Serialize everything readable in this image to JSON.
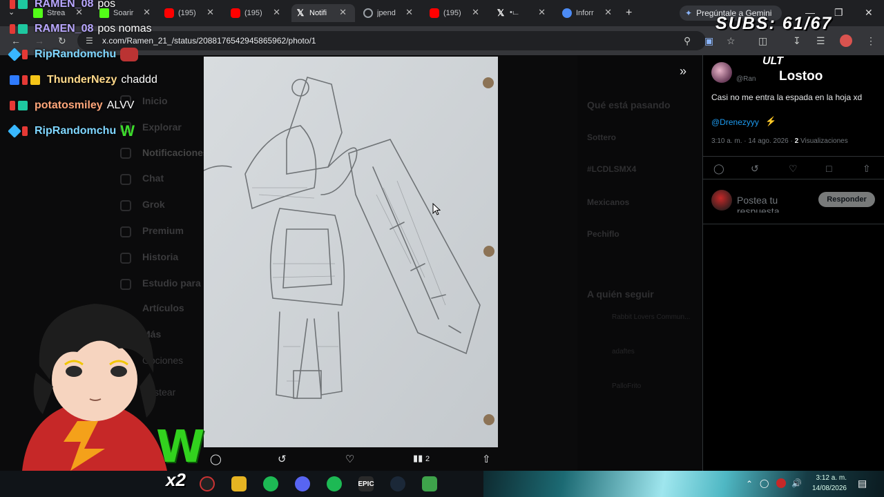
{
  "browser": {
    "tabs": [
      {
        "label": "Strea",
        "icon": "kick-icon",
        "color": "#53fc18"
      },
      {
        "label": "Soarir",
        "icon": "kick-icon",
        "color": "#53fc18"
      },
      {
        "label": "(195)",
        "icon": "youtube-icon",
        "color": "#ff0000"
      },
      {
        "label": "(195)",
        "icon": "youtube-icon",
        "color": "#ff0000"
      },
      {
        "label": "Notifi",
        "icon": "x-icon",
        "color": "#ffffff"
      },
      {
        "label": "jpend",
        "icon": "globe-icon",
        "color": "#9aa0a6"
      },
      {
        "label": "(195)",
        "icon": "youtube-icon",
        "color": "#ff0000"
      },
      {
        "label": "•ட",
        "icon": "x-icon",
        "color": "#ffffff"
      },
      {
        "label": "Inforr",
        "icon": "app-icon",
        "color": "#4c8bf5"
      }
    ],
    "gemini_label": "Pregúntale a Gemini",
    "url": "x.com/Ramen_21_/status/2088176542945865962/photo/1"
  },
  "x_nav": [
    "Inicio",
    "Explorar",
    "Notificaciones",
    "Chat",
    "Grok",
    "Premium",
    "Historia",
    "Estudio para",
    "Artículos",
    "Más",
    "Opciones",
    "Postear"
  ],
  "trends": {
    "heading": "Qué está pasando",
    "items": [
      "Sottero",
      "#LCDLSMX4",
      "Mexicanos",
      "Pechiflo"
    ],
    "who_to_follow": "A quién seguir",
    "suggestions": [
      "Rabbit Lovers Commun...",
      "adaftes",
      "PalloFrito"
    ]
  },
  "post": {
    "handle": "@Ran",
    "text": "Casi no me entra la espada en la hoja xd",
    "mention": "@Drenezyyy",
    "time": "3:10 a. m.",
    "date": "14 ago. 2026",
    "views_count": "2",
    "views_label": "Visualizaciones",
    "reply_placeholder": "Postea tu respuesta",
    "reply_button": "Responder"
  },
  "photo_bar": {
    "views": "2"
  },
  "chat": [
    {
      "user": "RAMEN_08",
      "msg": "pos",
      "color": "#b9a7ff",
      "badges": [
        "#e53935",
        "#1ec8a0"
      ]
    },
    {
      "user": "RAMEN_08",
      "msg": "pos nomas",
      "color": "#b9a7ff",
      "badges": [
        "#e53935",
        "#1ec8a0"
      ]
    },
    {
      "user": "RipRandomchu",
      "msg": "",
      "color": "#7fd6ff",
      "badges": [
        "#39b7ff",
        "#e53935"
      ]
    },
    {
      "user": "ThunderNezy",
      "msg": "chaddd",
      "color": "#ffd98a",
      "badges": [
        "#2f7bff",
        "#e53935",
        "#f5c518"
      ]
    },
    {
      "user": "potatosmiley",
      "msg": "ALVV",
      "color": "#ffa67a",
      "badges": [
        "#e53935",
        "#1ec8a0"
      ]
    },
    {
      "user": "RipRandomchu",
      "msg": "",
      "emote": "W",
      "color": "#7fd6ff",
      "badges": [
        "#39b7ff",
        "#e53935"
      ]
    }
  ],
  "overlay": {
    "subs": "SUBS: 61/67",
    "ult_tag": "ULT",
    "ult_name": "Lostoo",
    "w": "W",
    "x2": "x2"
  },
  "taskbar": {
    "time": "3:12 a. m.",
    "date": "14/08/2026",
    "apps": [
      "EPIC"
    ]
  }
}
